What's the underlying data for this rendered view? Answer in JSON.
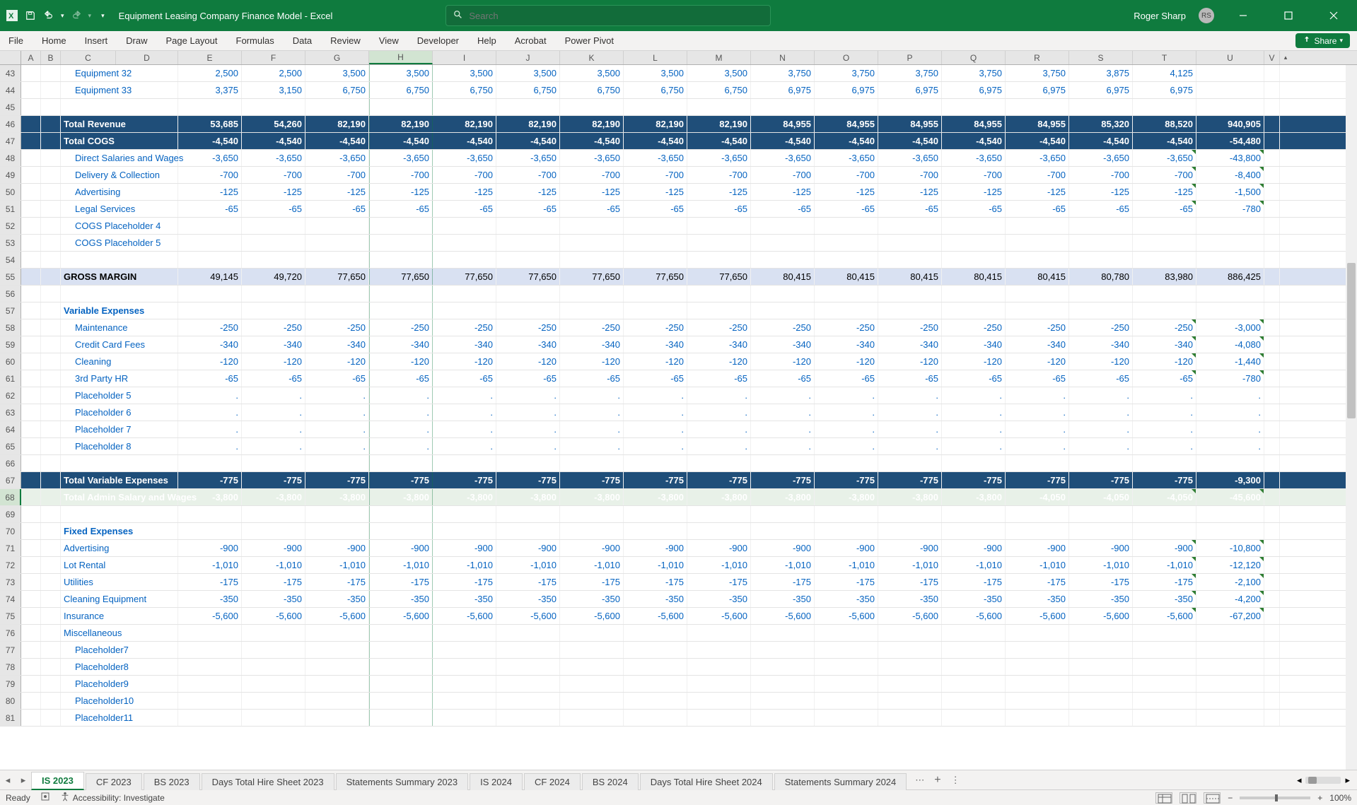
{
  "title": "Equipment Leasing Company Finance Model  -  Excel",
  "user": {
    "name": "Roger Sharp",
    "initials": "RS"
  },
  "search_placeholder": "Search",
  "menus": [
    "File",
    "Home",
    "Insert",
    "Draw",
    "Page Layout",
    "Formulas",
    "Data",
    "Review",
    "View",
    "Developer",
    "Help",
    "Acrobat",
    "Power Pivot"
  ],
  "share_label": "Share",
  "columns": [
    "A",
    "B",
    "C",
    "D",
    "E",
    "F",
    "G",
    "H",
    "I",
    "J",
    "K",
    "L",
    "M",
    "N",
    "O",
    "P",
    "Q",
    "R",
    "S",
    "T",
    "U",
    "V"
  ],
  "selected_col": "H",
  "selected_row": 68,
  "rows": [
    {
      "n": 43,
      "type": "data",
      "label": "Equipment 32",
      "indent": 1,
      "vals": [
        "2,500",
        "2,500",
        "3,500",
        "3,500",
        "3,500",
        "3,500",
        "3,500",
        "3,500",
        "3,500",
        "3,750",
        "3,750",
        "3,750",
        "3,750",
        "3,750",
        "3,875",
        "4,125",
        ""
      ]
    },
    {
      "n": 44,
      "type": "data",
      "label": "Equipment 33",
      "indent": 1,
      "vals": [
        "3,375",
        "3,150",
        "6,750",
        "6,750",
        "6,750",
        "6,750",
        "6,750",
        "6,750",
        "6,750",
        "6,975",
        "6,975",
        "6,975",
        "6,975",
        "6,975",
        "6,975",
        "6,975",
        ""
      ]
    },
    {
      "n": 45,
      "type": "blank"
    },
    {
      "n": 46,
      "type": "navy",
      "label": "Total Revenue",
      "vals": [
        "53,685",
        "54,260",
        "82,190",
        "82,190",
        "82,190",
        "82,190",
        "82,190",
        "82,190",
        "82,190",
        "84,955",
        "84,955",
        "84,955",
        "84,955",
        "84,955",
        "85,320",
        "88,520",
        "940,905"
      ]
    },
    {
      "n": 47,
      "type": "navy",
      "label": "Total COGS",
      "vals": [
        "-4,540",
        "-4,540",
        "-4,540",
        "-4,540",
        "-4,540",
        "-4,540",
        "-4,540",
        "-4,540",
        "-4,540",
        "-4,540",
        "-4,540",
        "-4,540",
        "-4,540",
        "-4,540",
        "-4,540",
        "-4,540",
        "-54,480"
      ]
    },
    {
      "n": 48,
      "type": "data",
      "label": "Direct Salaries and Wages",
      "indent": 1,
      "tri": true,
      "vals": [
        "-3,650",
        "-3,650",
        "-3,650",
        "-3,650",
        "-3,650",
        "-3,650",
        "-3,650",
        "-3,650",
        "-3,650",
        "-3,650",
        "-3,650",
        "-3,650",
        "-3,650",
        "-3,650",
        "-3,650",
        "-3,650",
        "-43,800"
      ]
    },
    {
      "n": 49,
      "type": "data",
      "label": "Delivery & Collection",
      "indent": 1,
      "tri": true,
      "vals": [
        "-700",
        "-700",
        "-700",
        "-700",
        "-700",
        "-700",
        "-700",
        "-700",
        "-700",
        "-700",
        "-700",
        "-700",
        "-700",
        "-700",
        "-700",
        "-700",
        "-8,400"
      ]
    },
    {
      "n": 50,
      "type": "data",
      "label": "Advertising",
      "indent": 1,
      "tri": true,
      "vals": [
        "-125",
        "-125",
        "-125",
        "-125",
        "-125",
        "-125",
        "-125",
        "-125",
        "-125",
        "-125",
        "-125",
        "-125",
        "-125",
        "-125",
        "-125",
        "-125",
        "-1,500"
      ]
    },
    {
      "n": 51,
      "type": "data",
      "label": "Legal Services",
      "indent": 1,
      "tri": true,
      "vals": [
        "-65",
        "-65",
        "-65",
        "-65",
        "-65",
        "-65",
        "-65",
        "-65",
        "-65",
        "-65",
        "-65",
        "-65",
        "-65",
        "-65",
        "-65",
        "-65",
        "-780"
      ]
    },
    {
      "n": 52,
      "type": "data",
      "label": "COGS Placeholder 4",
      "indent": 1,
      "vals": [
        "",
        "",
        "",
        "",
        "",
        "",
        "",
        "",
        "",
        "",
        "",
        "",
        "",
        "",
        "",
        "",
        ""
      ]
    },
    {
      "n": 53,
      "type": "data",
      "label": "COGS Placeholder 5",
      "indent": 1,
      "vals": [
        "",
        "",
        "",
        "",
        "",
        "",
        "",
        "",
        "",
        "",
        "",
        "",
        "",
        "",
        "",
        "",
        ""
      ]
    },
    {
      "n": 54,
      "type": "blank"
    },
    {
      "n": 55,
      "type": "lightblue",
      "label": "GROSS MARGIN",
      "bold": true,
      "black": true,
      "vals": [
        "49,145",
        "49,720",
        "77,650",
        "77,650",
        "77,650",
        "77,650",
        "77,650",
        "77,650",
        "77,650",
        "80,415",
        "80,415",
        "80,415",
        "80,415",
        "80,415",
        "80,780",
        "83,980",
        "886,425"
      ]
    },
    {
      "n": 56,
      "type": "blank"
    },
    {
      "n": 57,
      "type": "data",
      "label": "Variable Expenses",
      "bold": true,
      "vals": [
        "",
        "",
        "",
        "",
        "",
        "",
        "",
        "",
        "",
        "",
        "",
        "",
        "",
        "",
        "",
        "",
        ""
      ]
    },
    {
      "n": 58,
      "type": "data",
      "label": "Maintenance",
      "indent": 1,
      "tri": true,
      "vals": [
        "-250",
        "-250",
        "-250",
        "-250",
        "-250",
        "-250",
        "-250",
        "-250",
        "-250",
        "-250",
        "-250",
        "-250",
        "-250",
        "-250",
        "-250",
        "-250",
        "-3,000"
      ]
    },
    {
      "n": 59,
      "type": "data",
      "label": "Credit Card Fees",
      "indent": 1,
      "tri": true,
      "vals": [
        "-340",
        "-340",
        "-340",
        "-340",
        "-340",
        "-340",
        "-340",
        "-340",
        "-340",
        "-340",
        "-340",
        "-340",
        "-340",
        "-340",
        "-340",
        "-340",
        "-4,080"
      ]
    },
    {
      "n": 60,
      "type": "data",
      "label": "Cleaning",
      "indent": 1,
      "tri": true,
      "vals": [
        "-120",
        "-120",
        "-120",
        "-120",
        "-120",
        "-120",
        "-120",
        "-120",
        "-120",
        "-120",
        "-120",
        "-120",
        "-120",
        "-120",
        "-120",
        "-120",
        "-1,440"
      ]
    },
    {
      "n": 61,
      "type": "data",
      "label": "3rd Party HR",
      "indent": 1,
      "tri": true,
      "vals": [
        "-65",
        "-65",
        "-65",
        "-65",
        "-65",
        "-65",
        "-65",
        "-65",
        "-65",
        "-65",
        "-65",
        "-65",
        "-65",
        "-65",
        "-65",
        "-65",
        "-780"
      ]
    },
    {
      "n": 62,
      "type": "dotrow",
      "label": "Placeholder 5",
      "indent": 1
    },
    {
      "n": 63,
      "type": "dotrow",
      "label": "Placeholder 6",
      "indent": 1
    },
    {
      "n": 64,
      "type": "dotrow",
      "label": "Placeholder 7",
      "indent": 1
    },
    {
      "n": 65,
      "type": "dotrow",
      "label": "Placeholder 8",
      "indent": 1
    },
    {
      "n": 66,
      "type": "blank"
    },
    {
      "n": 67,
      "type": "navy",
      "label": "Total Variable Expenses",
      "vals": [
        "-775",
        "-775",
        "-775",
        "-775",
        "-775",
        "-775",
        "-775",
        "-775",
        "-775",
        "-775",
        "-775",
        "-775",
        "-775",
        "-775",
        "-775",
        "-775",
        "-9,300"
      ]
    },
    {
      "n": 68,
      "type": "navy",
      "label": "Total Admin Salary and Wages",
      "sel": true,
      "tri": true,
      "vals": [
        "-3,800",
        "-3,800",
        "-3,800",
        "-3,800",
        "-3,800",
        "-3,800",
        "-3,800",
        "-3,800",
        "-3,800",
        "-3,800",
        "-3,800",
        "-3,800",
        "-3,800",
        "-4,050",
        "-4,050",
        "-4,050",
        "-45,600"
      ]
    },
    {
      "n": 69,
      "type": "blank"
    },
    {
      "n": 70,
      "type": "data",
      "label": "Fixed Expenses",
      "bold": true,
      "vals": [
        "",
        "",
        "",
        "",
        "",
        "",
        "",
        "",
        "",
        "",
        "",
        "",
        "",
        "",
        "",
        "",
        ""
      ]
    },
    {
      "n": 71,
      "type": "data",
      "label": "Advertising",
      "indent": 0,
      "tri": true,
      "vals": [
        "-900",
        "-900",
        "-900",
        "-900",
        "-900",
        "-900",
        "-900",
        "-900",
        "-900",
        "-900",
        "-900",
        "-900",
        "-900",
        "-900",
        "-900",
        "-900",
        "-10,800"
      ]
    },
    {
      "n": 72,
      "type": "data",
      "label": "Lot Rental",
      "indent": 0,
      "tri": true,
      "vals": [
        "-1,010",
        "-1,010",
        "-1,010",
        "-1,010",
        "-1,010",
        "-1,010",
        "-1,010",
        "-1,010",
        "-1,010",
        "-1,010",
        "-1,010",
        "-1,010",
        "-1,010",
        "-1,010",
        "-1,010",
        "-1,010",
        "-12,120"
      ]
    },
    {
      "n": 73,
      "type": "data",
      "label": "Utilities",
      "indent": 0,
      "tri": true,
      "vals": [
        "-175",
        "-175",
        "-175",
        "-175",
        "-175",
        "-175",
        "-175",
        "-175",
        "-175",
        "-175",
        "-175",
        "-175",
        "-175",
        "-175",
        "-175",
        "-175",
        "-2,100"
      ]
    },
    {
      "n": 74,
      "type": "data",
      "label": "Cleaning Equipment",
      "indent": 0,
      "tri": true,
      "vals": [
        "-350",
        "-350",
        "-350",
        "-350",
        "-350",
        "-350",
        "-350",
        "-350",
        "-350",
        "-350",
        "-350",
        "-350",
        "-350",
        "-350",
        "-350",
        "-350",
        "-4,200"
      ]
    },
    {
      "n": 75,
      "type": "data",
      "label": "Insurance",
      "indent": 0,
      "tri": true,
      "vals": [
        "-5,600",
        "-5,600",
        "-5,600",
        "-5,600",
        "-5,600",
        "-5,600",
        "-5,600",
        "-5,600",
        "-5,600",
        "-5,600",
        "-5,600",
        "-5,600",
        "-5,600",
        "-5,600",
        "-5,600",
        "-5,600",
        "-67,200"
      ]
    },
    {
      "n": 76,
      "type": "data",
      "label": "Miscellaneous",
      "indent": 0,
      "vals": [
        "",
        "",
        "",
        "",
        "",
        "",
        "",
        "",
        "",
        "",
        "",
        "",
        "",
        "",
        "",
        "",
        ""
      ]
    },
    {
      "n": 77,
      "type": "data",
      "label": "Placeholder7",
      "indent": 1,
      "vals": [
        "",
        "",
        "",
        "",
        "",
        "",
        "",
        "",
        "",
        "",
        "",
        "",
        "",
        "",
        "",
        "",
        ""
      ]
    },
    {
      "n": 78,
      "type": "data",
      "label": "Placeholder8",
      "indent": 1,
      "vals": [
        "",
        "",
        "",
        "",
        "",
        "",
        "",
        "",
        "",
        "",
        "",
        "",
        "",
        "",
        "",
        "",
        ""
      ]
    },
    {
      "n": 79,
      "type": "data",
      "label": "Placeholder9",
      "indent": 1,
      "vals": [
        "",
        "",
        "",
        "",
        "",
        "",
        "",
        "",
        "",
        "",
        "",
        "",
        "",
        "",
        "",
        "",
        ""
      ]
    },
    {
      "n": 80,
      "type": "data",
      "label": "Placeholder10",
      "indent": 1,
      "vals": [
        "",
        "",
        "",
        "",
        "",
        "",
        "",
        "",
        "",
        "",
        "",
        "",
        "",
        "",
        "",
        "",
        ""
      ]
    },
    {
      "n": 81,
      "type": "data",
      "label": "Placeholder11",
      "indent": 1,
      "vals": [
        "",
        "",
        "",
        "",
        "",
        "",
        "",
        "",
        "",
        "",
        "",
        "",
        "",
        "",
        "",
        "",
        ""
      ]
    }
  ],
  "tabs": [
    "IS 2023",
    "CF 2023",
    "BS 2023",
    "Days Total Hire Sheet 2023",
    "Statements Summary 2023",
    "IS 2024",
    "CF 2024",
    "BS 2024",
    "Days Total Hire Sheet 2024",
    "Statements Summary 2024"
  ],
  "active_tab": 0,
  "status": {
    "ready": "Ready",
    "access": "Accessibility: Investigate",
    "zoom": "100%"
  }
}
